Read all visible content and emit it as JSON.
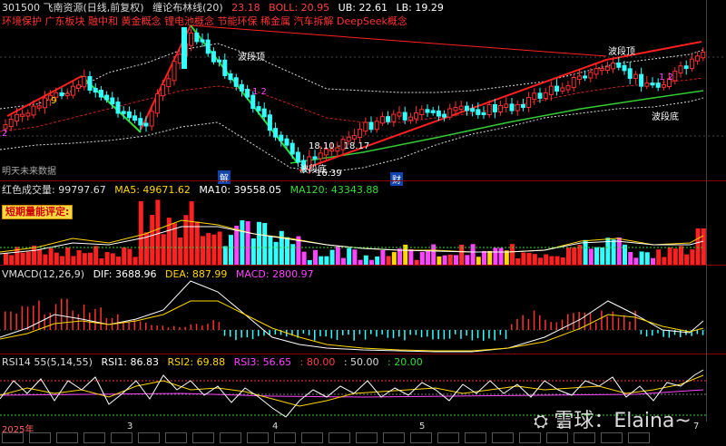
{
  "main": {
    "code_name": "301500 飞南资源(日线,前复权)",
    "indicator": "布林线(20)",
    "indicator_prefix": "缠论",
    "values": [
      {
        "label": "",
        "value": "23.18",
        "color": "#ff4040"
      },
      {
        "label": "BOLL: ",
        "value": "20.95",
        "color": "#ff4040"
      },
      {
        "label": "UB: ",
        "value": "22.61",
        "color": "#ffffff"
      },
      {
        "label": "LB: ",
        "value": "19.29",
        "color": "#ffffff"
      }
    ],
    "concepts": "环境保护 广东板块 融中和 黄金概念 锂电池概念 节能环保 稀金属 汽车拆解 DeepSeek概念",
    "price_labels": [
      "18.10 - 18.17",
      "16.39"
    ],
    "wave_top_1": "波段顶",
    "wave_top_2": "波段顶",
    "wave_bottom": "波段底",
    "wave_bottom_2": "波段底",
    "nums": [
      "9",
      "2",
      "1 2",
      "1 2"
    ],
    "markers": [
      "解",
      "财"
    ],
    "future_label": "明天未来数据"
  },
  "vol": {
    "title": "红色成交量: ",
    "value": "99797.67",
    "ma5": "MA5: 49671.62",
    "ma10": "MA10: 39558.05",
    "ma120": "MA120: 43343.88",
    "button": "短期量能评定:"
  },
  "macd": {
    "title": "VMACD(12,26,9)",
    "dif": "DIF: 3688.96",
    "dea": "DEA: 887.99",
    "macd": "MACD: 2800.97"
  },
  "rsi": {
    "title": "RSI14 55(5,14,55)",
    "rsi1": "RSI1: 86.83",
    "rsi2": "RSI2: 69.88",
    "rsi3": "RSI3: 56.65",
    "l80": ": 80.00",
    "l50": ": 50.00",
    "l20": ": 20.00"
  },
  "time_axis": {
    "labels": [
      "2025年",
      "3",
      "4",
      "5",
      "6",
      "7"
    ]
  },
  "watermark": "雪球：Elaina~"
}
